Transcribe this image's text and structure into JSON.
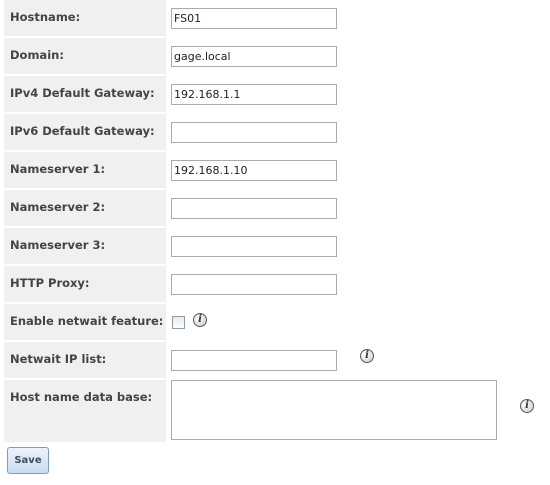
{
  "fields": [
    {
      "label": "Hostname:",
      "value": "FS01"
    },
    {
      "label": "Domain:",
      "value": "gage.local"
    },
    {
      "label": "IPv4 Default Gateway:",
      "value": "192.168.1.1"
    },
    {
      "label": "IPv6 Default Gateway:",
      "value": ""
    },
    {
      "label": "Nameserver 1:",
      "value": "192.168.1.10"
    },
    {
      "label": "Nameserver 2:",
      "value": ""
    },
    {
      "label": "Nameserver 3:",
      "value": ""
    },
    {
      "label": "HTTP Proxy:",
      "value": ""
    }
  ],
  "netwait": {
    "label": "Enable netwait feature:",
    "checked": false,
    "info_icon": "info-icon"
  },
  "netwait_ip": {
    "label": "Netwait IP list:",
    "value": "",
    "info_icon": "info-icon"
  },
  "host_db": {
    "label": "Host name data base:",
    "value": "",
    "info_icon": "info-icon"
  },
  "info_glyph": "i",
  "save_label": "Save"
}
